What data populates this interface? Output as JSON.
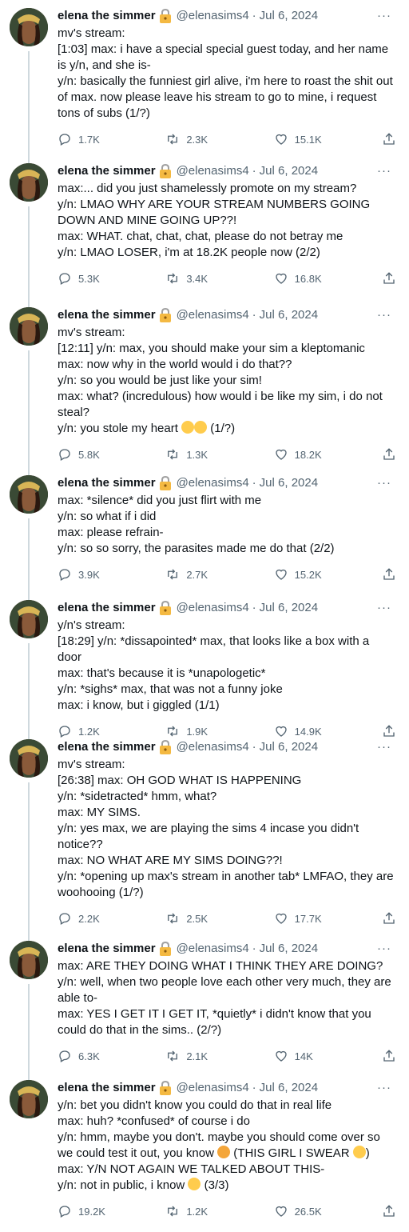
{
  "author": {
    "name": "elena the simmer",
    "handle": "@elenasims4",
    "separator": "·",
    "date": "Jul 6, 2024"
  },
  "more_label": "···",
  "tweets": [
    {
      "lines": [
        "mv's stream:",
        "[1:03] max: i have a special special guest today, and her name is y/n, and she is-",
        "y/n: basically the funniest girl alive, i'm here to roast the shit out of max. now please leave his stream to go to mine, i request tons of subs (1/?)"
      ],
      "replies": "1.7K",
      "retweets": "2.3K",
      "likes": "15.1K"
    },
    {
      "lines": [
        "max:... did you just shamelessly promote on my stream?",
        "y/n: LMAO WHY ARE YOUR STREAM NUMBERS GOING DOWN AND MINE GOING UP??!",
        "max: WHAT. chat, chat, chat, please do not betray me",
        "y/n: LMAO LOSER, i'm at 18.2K people now (2/2)"
      ],
      "replies": "5.3K",
      "retweets": "3.4K",
      "likes": "16.8K"
    },
    {
      "lines": [
        "mv's stream:",
        "[12:11] y/n: max, you should make your sim a kleptomanic",
        "max: now why in the world would i do that??",
        "y/n: so you would be just like your sim!",
        "max: what? (incredulous) how would i be like my sim, i do not steal?",
        "y/n: you stole my heart"
      ],
      "heart_suffix": "(1/?)",
      "replies": "5.8K",
      "retweets": "1.3K",
      "likes": "18.2K"
    },
    {
      "lines": [
        "max: *silence* did you just flirt with me",
        "y/n: so what if i did",
        "max: please refrain-",
        "y/n: so so sorry, the parasites made me do that (2/2)"
      ],
      "replies": "3.9K",
      "retweets": "2.7K",
      "likes": "15.2K"
    },
    {
      "lines": [
        "y/n's stream:",
        "[18:29] y/n: *dissapointed* max, that looks like a box with a door",
        "max: that's because it is *unapologetic*",
        "y/n: *sighs* max, that was not a funny joke",
        "max: i know, but i giggled (1/1)"
      ],
      "replies": "1.2K",
      "retweets": "1.9K",
      "likes": "14.9K"
    },
    {
      "lines": [
        "mv's stream:",
        "[26:38] max: OH GOD WHAT IS HAPPENING",
        "y/n: *sidetracted* hmm, what?",
        "max: MY SIMS.",
        "y/n: yes max, we are playing the sims 4 incase you didn't notice??",
        "max: NO WHAT ARE MY SIMS DOING??!",
        "y/n: *opening up max's stream in another tab* LMFAO, they are woohooing (1/?)"
      ],
      "replies": "2.2K",
      "retweets": "2.5K",
      "likes": "17.7K"
    },
    {
      "lines": [
        "max: ARE THEY DOING WHAT I THINK THEY ARE DOING?",
        "y/n: well, when two people love each other very much, they are able to-",
        "max: YES I GET IT I GET IT, *quietly* i didn't know that you could do that in the sims.. (2/?)"
      ],
      "replies": "6.3K",
      "retweets": "2.1K",
      "likes": "14K"
    },
    {
      "lines": [
        "y/n: bet you didn't know you could do that in real life",
        "max: huh? *confused* of course i do",
        "y/n: hmm, maybe you don't. maybe you should come over so we could test it out, you know",
        "max: Y/N NOT AGAIN WE TALKED ABOUT THIS-",
        "y/n: not in public, i know"
      ],
      "devil_suffix": "(THIS GIRL I SWEAR",
      "devil_close": ")",
      "final_suffix": "(3/3)",
      "replies": "19.2K",
      "retweets": "1.2K",
      "likes": "26.5K"
    }
  ],
  "icons": {
    "reply": "reply-icon",
    "retweet": "retweet-icon",
    "like": "like-icon",
    "share": "share-icon",
    "lock": "lock-emoji-icon"
  },
  "colors": {
    "text": "#0f1419",
    "muted": "#536471",
    "thread_line": "#cfd9de",
    "emoji_yellow": "#ffcc4d"
  }
}
